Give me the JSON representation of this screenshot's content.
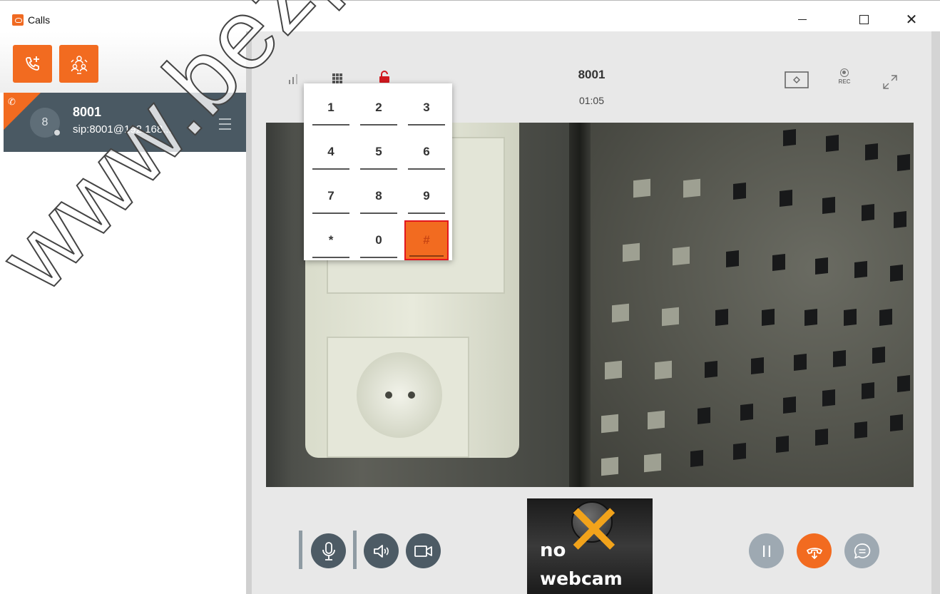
{
  "window": {
    "title": "Calls",
    "controls": {
      "minimize": "–",
      "maximize": "☐",
      "close": "✕"
    }
  },
  "sidebar": {
    "buttons": [
      {
        "name": "new-call",
        "icon": "phone-plus-icon"
      },
      {
        "name": "conference",
        "icon": "conference-icon"
      }
    ],
    "calls": [
      {
        "avatar": "8",
        "name": "8001",
        "sip": "sip:8001@192.168...",
        "status": "active-call"
      }
    ]
  },
  "call": {
    "remote_name": "8001",
    "duration": "01:05",
    "rec_label": "REC"
  },
  "keypad": {
    "keys": [
      "1",
      "2",
      "3",
      "4",
      "5",
      "6",
      "7",
      "8",
      "9",
      "*",
      "0",
      "#"
    ],
    "active_key": "#"
  },
  "self_view": {
    "line1": "no",
    "line2": "webcam"
  },
  "watermark": "www.bezpeka",
  "colors": {
    "accent": "#f26b20",
    "sidebar_selected": "#4a5963",
    "button_dark": "#4d5b65",
    "button_grey": "#9ea9b2",
    "active_key_border": "#e3161e"
  }
}
